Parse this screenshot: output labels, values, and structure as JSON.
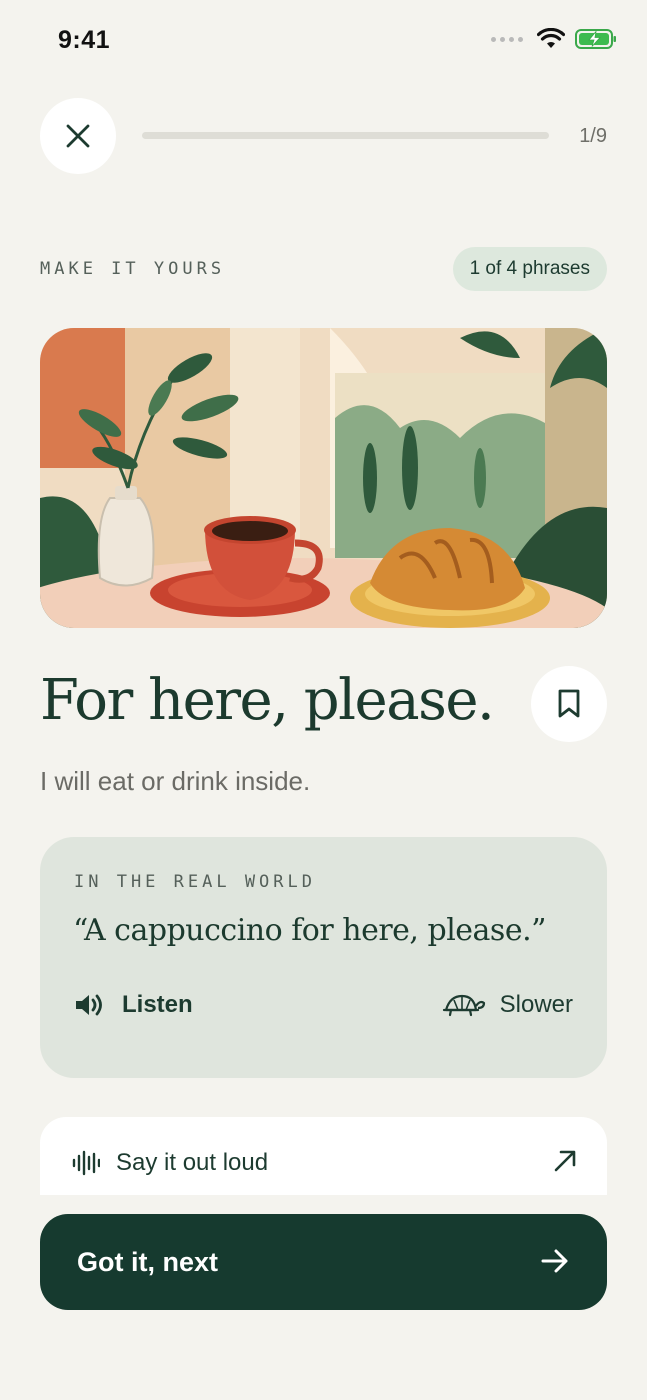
{
  "status_bar": {
    "time": "9:41"
  },
  "progress": {
    "label": "1/9",
    "fraction": 0
  },
  "section": {
    "label": "MAKE IT YOURS",
    "phrase_count": "1 of 4 phrases"
  },
  "hero": {
    "icon": "cafe-illustration",
    "description_hidden": ""
  },
  "phrase": {
    "title": "For here, please.",
    "meaning": "I will eat or drink inside."
  },
  "real_world": {
    "label": "IN THE REAL WORLD",
    "quote": "“A cappuccino for here, please.”",
    "listen_label": "Listen",
    "slower_label": "Slower"
  },
  "practice": {
    "label": "Say it out loud"
  },
  "footer": {
    "next_label": "Got it, next"
  },
  "colors": {
    "background": "#f4f3ee",
    "primary": "#163a2f",
    "pill": "#dde8dd",
    "card": "#dfe5dd"
  },
  "icons": [
    "close-icon",
    "bookmark-icon",
    "speaker-icon",
    "turtle-icon",
    "waveform-icon",
    "arrow-up-right-icon",
    "arrow-right-icon",
    "wifi-icon",
    "battery-icon"
  ]
}
